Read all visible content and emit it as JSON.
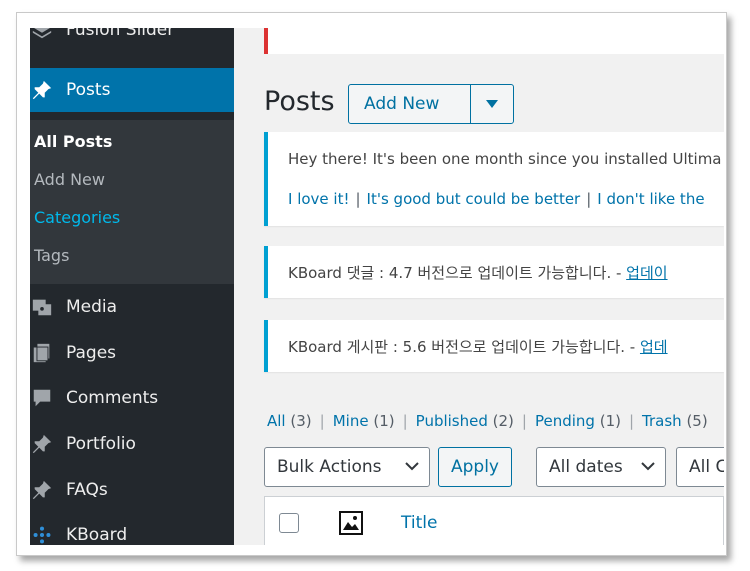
{
  "sidebar": {
    "fusion_slider": "Fusion Slider",
    "posts": "Posts",
    "submenu": {
      "all_posts": "All Posts",
      "add_new": "Add New",
      "categories": "Categories",
      "tags": "Tags"
    },
    "media": "Media",
    "pages": "Pages",
    "comments": "Comments",
    "portfolio": "Portfolio",
    "faqs": "FAQs",
    "kboard": "KBoard"
  },
  "header": {
    "title": "Posts",
    "add_new_label": "Add New"
  },
  "notices": {
    "ultimate": {
      "text": "Hey there! It's been one month since you installed Ultima",
      "link_love": "I love it!",
      "link_good": "It's good but could be better",
      "link_dislike": "I don't like the"
    },
    "kboard_comments": {
      "text": "KBoard 댓글 : 4.7 버전으로 업데이트 가능합니다. - ",
      "link": "업데이"
    },
    "kboard_board": {
      "text": "KBoard 게시판 : 5.6 버전으로 업데이트 가능합니다. - ",
      "link": "업데"
    }
  },
  "filters": {
    "all": "All",
    "all_count": "(3)",
    "mine": "Mine",
    "mine_count": "(1)",
    "published": "Published",
    "published_count": "(2)",
    "pending": "Pending",
    "pending_count": "(1)",
    "trash": "Trash",
    "trash_count": "(5)",
    "separator": "|"
  },
  "toolbar": {
    "bulk_actions": "Bulk Actions",
    "apply": "Apply",
    "all_dates": "All dates",
    "all_categories": "All C"
  },
  "table": {
    "title_column": "Title"
  },
  "colors": {
    "sidebar_bg": "#23282d",
    "submenu_bg": "#32373c",
    "active_bg": "#0073aa",
    "link": "#0073aa",
    "notice_info": "#00a0d2",
    "notice_error": "#dc3232"
  }
}
